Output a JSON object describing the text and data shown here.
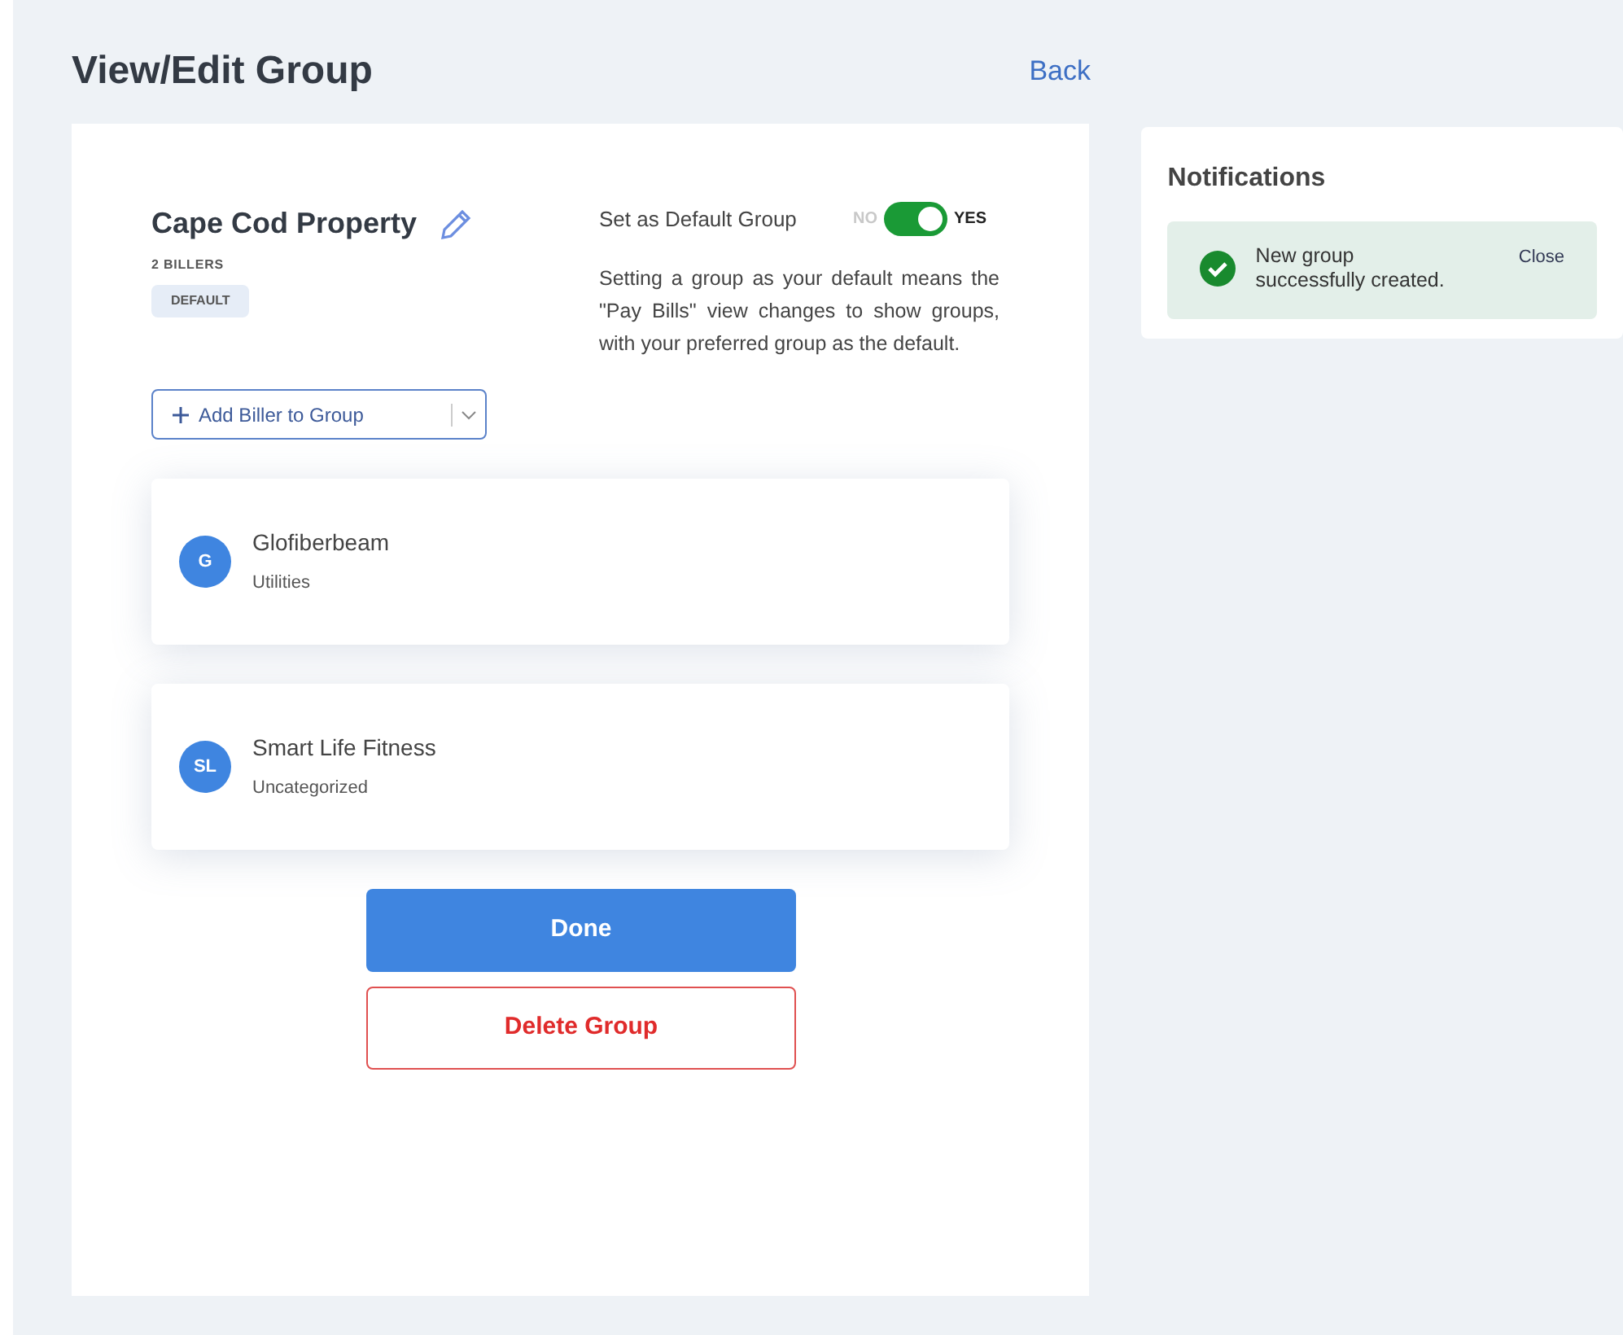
{
  "page": {
    "title": "View/Edit Group",
    "back_link": "Back"
  },
  "group": {
    "name": "Cape Cod Property",
    "count": "2 BILLERS",
    "badge": "DEFAULT"
  },
  "default_setting": {
    "label": "Set as Default Group",
    "off_label": "NO",
    "on_label": "YES",
    "on": true,
    "description": "Setting a group as your default means the \"Pay Bills\" view changes to show groups, with your preferred group as the default."
  },
  "add_button": {
    "label": "Add Biller to Group"
  },
  "billers": [
    {
      "initials": "G",
      "name": "Glofiberbeam",
      "category": "Utilities"
    },
    {
      "initials": "SL",
      "name": "Smart Life Fitness",
      "category": "Uncategorized"
    }
  ],
  "buttons": {
    "done": "Done",
    "delete": "Delete Group"
  },
  "notifications": {
    "title": "Notifications",
    "items": [
      {
        "message": "New group successfully created.",
        "close": "Close"
      }
    ]
  }
}
